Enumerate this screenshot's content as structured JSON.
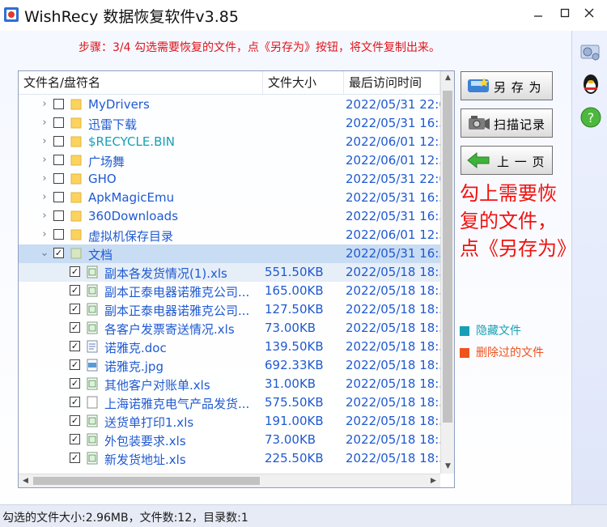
{
  "window": {
    "title": "WishRecy 数据恢复软件v3.85"
  },
  "step_text": "步骤：3/4 勾选需要恢复的文件，点《另存为》按钮，将文件复制出来。",
  "columns": {
    "name": "文件名/盘符名",
    "size": "文件大小",
    "date": "最后访问时间"
  },
  "rows": [
    {
      "kind": "folder",
      "name": "MyDrivers",
      "size": "",
      "date": "2022/05/31 22:0",
      "checked": false,
      "style": "folder"
    },
    {
      "kind": "folder",
      "name": "迅雷下载",
      "size": "",
      "date": "2022/05/31 16:5",
      "checked": false,
      "style": "folder"
    },
    {
      "kind": "folder",
      "name": "$RECYCLE.BIN",
      "size": "",
      "date": "2022/06/01 12:3",
      "checked": false,
      "style": "hidden"
    },
    {
      "kind": "folder",
      "name": "广场舞",
      "size": "",
      "date": "2022/06/01 12:3",
      "checked": false,
      "style": "folder"
    },
    {
      "kind": "folder",
      "name": "GHO",
      "size": "",
      "date": "2022/05/31 22:0",
      "checked": false,
      "style": "folder"
    },
    {
      "kind": "folder",
      "name": "ApkMagicEmu",
      "size": "",
      "date": "2022/05/31 16:5",
      "checked": false,
      "style": "folder"
    },
    {
      "kind": "folder",
      "name": "360Downloads",
      "size": "",
      "date": "2022/05/31 16:5",
      "checked": false,
      "style": "folder"
    },
    {
      "kind": "folder",
      "name": "虚拟机保存目录",
      "size": "",
      "date": "2022/06/01 12:3",
      "checked": false,
      "style": "folder"
    },
    {
      "kind": "folder-open",
      "name": "文档",
      "size": "",
      "date": "2022/05/31 16:5",
      "checked": true,
      "style": "folder"
    },
    {
      "kind": "file",
      "name": "副本各发货情况(1).xls",
      "size": "551.50KB",
      "date": "2022/05/18 18:5",
      "checked": true,
      "style": "file",
      "icon": "xls"
    },
    {
      "kind": "file",
      "name": "副本正泰电器诺雅克公司...",
      "size": "165.00KB",
      "date": "2022/05/18 18:5",
      "checked": true,
      "style": "file",
      "icon": "xls"
    },
    {
      "kind": "file",
      "name": "副本正泰电器诺雅克公司...",
      "size": "127.50KB",
      "date": "2022/05/18 18:5",
      "checked": true,
      "style": "file",
      "icon": "xls"
    },
    {
      "kind": "file",
      "name": "各客户发票寄送情况.xls",
      "size": "73.00KB",
      "date": "2022/05/18 18:5",
      "checked": true,
      "style": "file",
      "icon": "xls"
    },
    {
      "kind": "file",
      "name": "诺雅克.doc",
      "size": "139.50KB",
      "date": "2022/05/18 18:5",
      "checked": true,
      "style": "file",
      "icon": "doc"
    },
    {
      "kind": "file",
      "name": "诺雅克.jpg",
      "size": "692.33KB",
      "date": "2022/05/18 18:5",
      "checked": true,
      "style": "file",
      "icon": "jpg"
    },
    {
      "kind": "file",
      "name": "其他客户对账单.xls",
      "size": "31.00KB",
      "date": "2022/05/18 18:5",
      "checked": true,
      "style": "file",
      "icon": "xls"
    },
    {
      "kind": "file",
      "name": "上海诺雅克电气产品发货...",
      "size": "575.50KB",
      "date": "2022/05/18 18:5",
      "checked": true,
      "style": "file",
      "icon": "blank"
    },
    {
      "kind": "file",
      "name": "送货单打印1.xls",
      "size": "191.00KB",
      "date": "2022/05/18 18:5",
      "checked": true,
      "style": "file",
      "icon": "xls"
    },
    {
      "kind": "file",
      "name": "外包装要求.xls",
      "size": "73.00KB",
      "date": "2022/05/18 18:5",
      "checked": true,
      "style": "file",
      "icon": "xls"
    },
    {
      "kind": "file",
      "name": "新发货地址.xls",
      "size": "225.50KB",
      "date": "2022/05/18 18:5",
      "checked": true,
      "style": "file",
      "icon": "xls"
    }
  ],
  "buttons": {
    "save_as": "另 存 为",
    "scan_record": "扫描记录",
    "prev_page": "上 一 页"
  },
  "hint": "勾上需要恢复的文件，点《另存为》",
  "legend": {
    "hidden": "隐藏文件",
    "deleted": "删除过的文件",
    "hidden_color": "#17a0b5",
    "deleted_color": "#f0521c"
  },
  "status": "勾选的文件大小:2.96MB，文件数:12，目录数:1",
  "icons": {
    "app": "recovery-app-icon",
    "strip": [
      "settings-gears-icon",
      "qq-penguin-icon",
      "help-question-icon"
    ]
  }
}
